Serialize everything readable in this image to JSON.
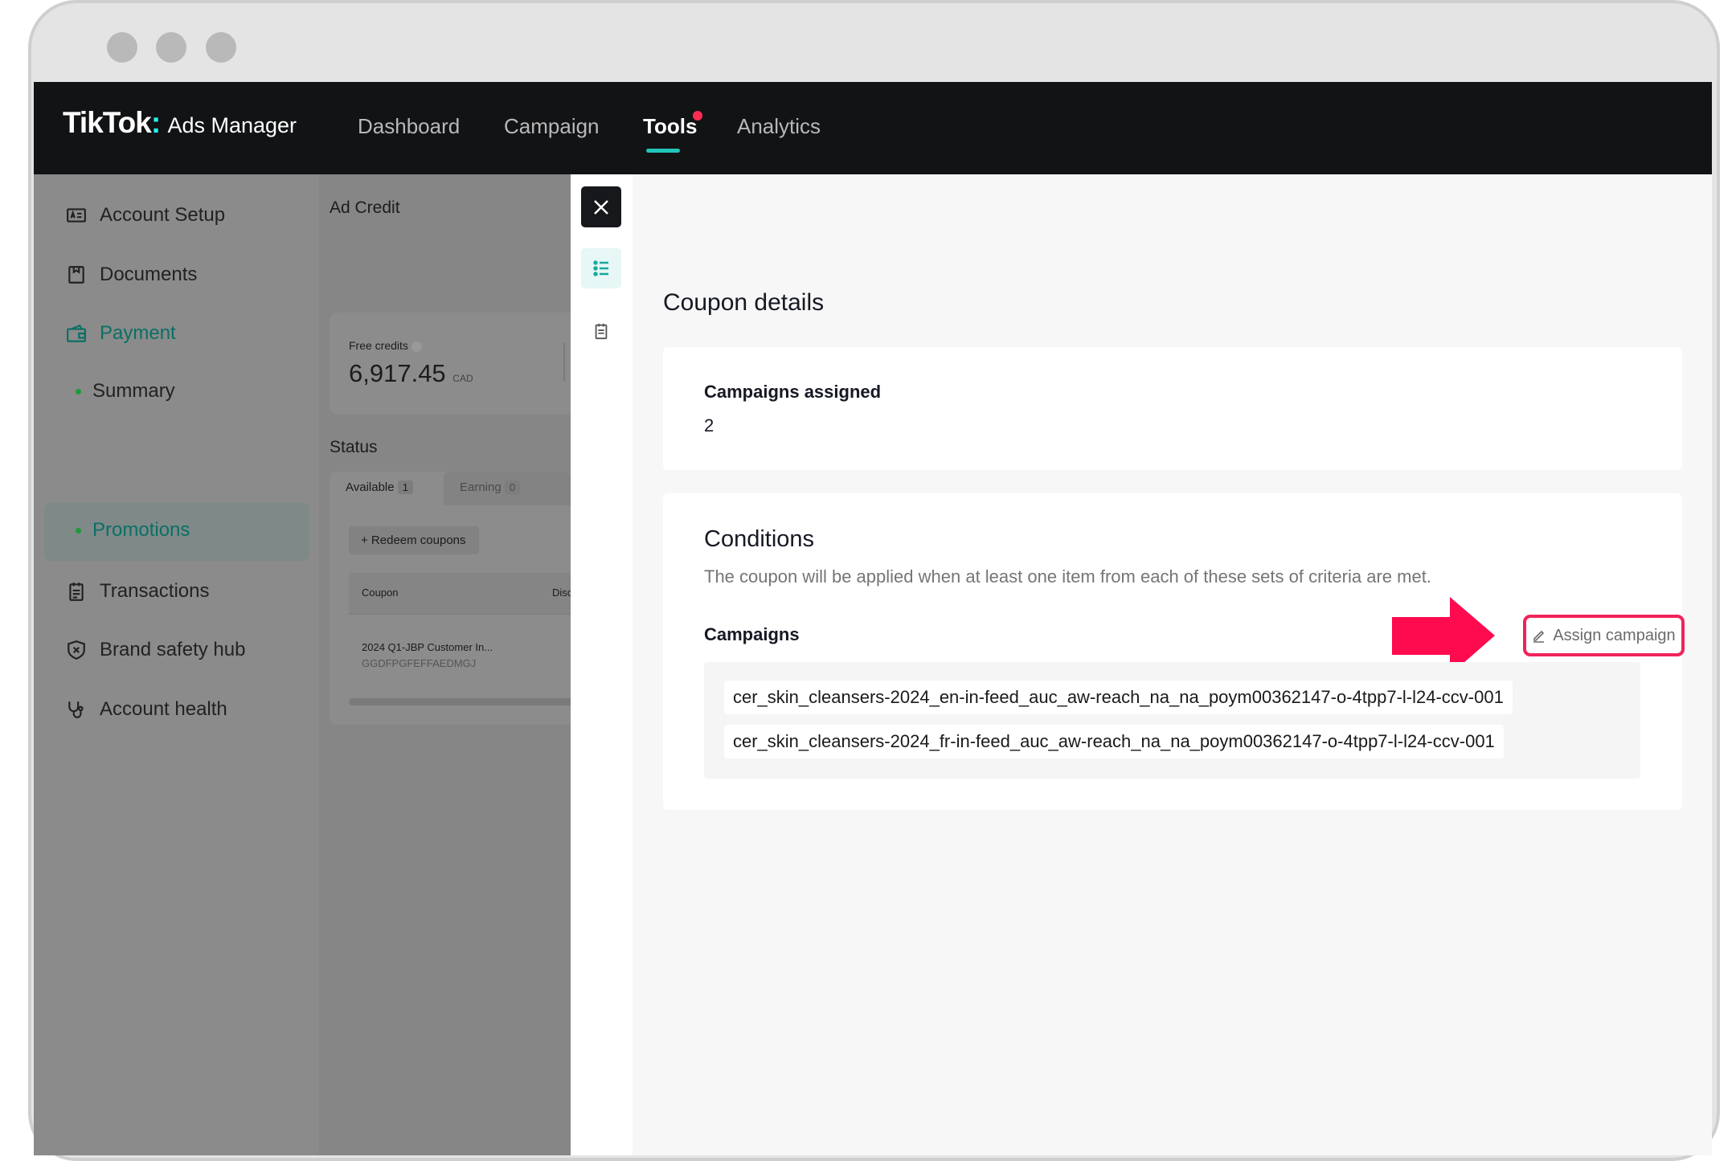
{
  "header": {
    "logo_brand": "TikTok",
    "logo_colon": ":",
    "logo_product": "Ads Manager",
    "nav": [
      {
        "label": "Dashboard",
        "active": false
      },
      {
        "label": "Campaign",
        "active": false
      },
      {
        "label": "Tools",
        "active": true,
        "notification_dot": true
      },
      {
        "label": "Analytics",
        "active": false
      }
    ]
  },
  "sidebar": {
    "items": [
      {
        "label": "Account Setup",
        "icon": "id-card-icon"
      },
      {
        "label": "Documents",
        "icon": "document-icon"
      },
      {
        "label": "Payment",
        "icon": "wallet-icon",
        "active": true
      },
      {
        "label": "Summary",
        "sub": true
      },
      {
        "label": "Promotions",
        "sub": true,
        "selected": true
      },
      {
        "label": "Transactions",
        "icon": "clipboard-icon"
      },
      {
        "label": "Brand safety hub",
        "icon": "shield-icon"
      },
      {
        "label": "Account health",
        "icon": "stethoscope-icon"
      }
    ]
  },
  "ad_credit": {
    "title": "Ad Credit",
    "free_credits_label": "Free credits",
    "free_credits_value": "6,917.45",
    "currency": "CAD",
    "status_title": "Status",
    "tabs": [
      {
        "label": "Available",
        "count": "1"
      },
      {
        "label": "Earning",
        "count": "0"
      }
    ],
    "redeem_label": "+ Redeem coupons",
    "table": {
      "columns": [
        "Coupon",
        "Disc"
      ],
      "rows": [
        {
          "name": "2024 Q1-JBP Customer In...",
          "code": "GGDFPGFEFFAEDMGJ"
        }
      ]
    }
  },
  "coupon_details": {
    "title": "Coupon details",
    "campaigns_assigned_label": "Campaigns assigned",
    "campaigns_assigned_value": "2",
    "conditions_title": "Conditions",
    "conditions_desc": "The coupon will be applied when at least one item from each of these sets of criteria are met.",
    "campaigns_label": "Campaigns",
    "assign_button": "Assign campaign",
    "campaigns": [
      "cer_skin_cleansers-2024_en-in-feed_auc_aw-reach_na_na_poym00362147-o-4tpp7-l-l24-ccv-001",
      "cer_skin_cleansers-2024_fr-in-feed_auc_aw-reach_na_na_poym00362147-o-4tpp7-l-l24-ccv-001"
    ]
  },
  "colors": {
    "accent_teal": "#20c5b8",
    "highlight_pink": "#fe0a4e",
    "header_bg": "#121315"
  }
}
